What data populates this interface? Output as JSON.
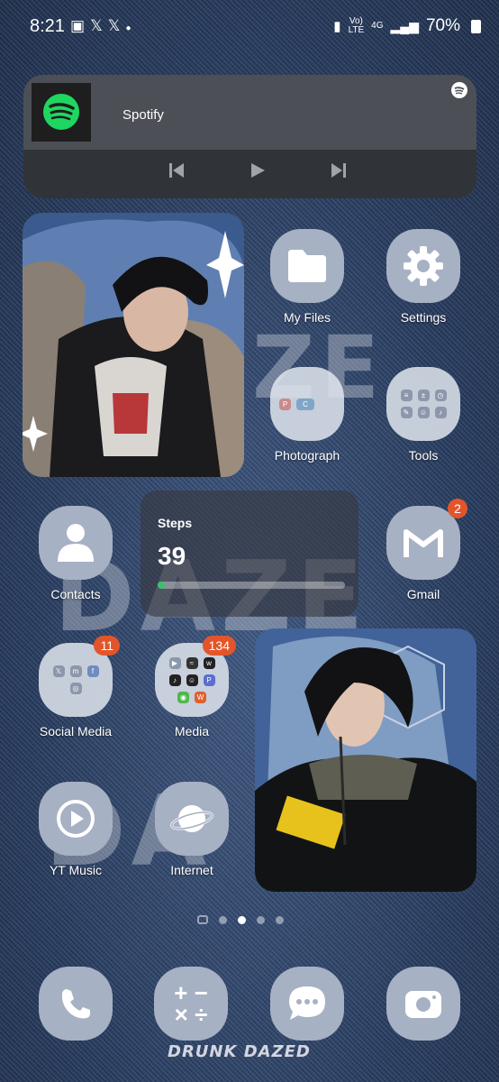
{
  "status_bar": {
    "time": "8:21",
    "left_icons": [
      "gallery-icon",
      "x-icon",
      "x-icon",
      "dot-icon"
    ],
    "network": "4G",
    "lte": "LTE",
    "battery": "70%"
  },
  "media_widget": {
    "app_name": "Spotify",
    "controls": [
      "previous",
      "play",
      "next"
    ]
  },
  "wallpaper_text": [
    "ZE",
    "DAZE",
    "DA",
    "DRUNK DAZED"
  ],
  "apps": {
    "my_files": "My Files",
    "settings": "Settings",
    "photograph": "Photograph",
    "tools": "Tools",
    "contacts": "Contacts",
    "gmail": "Gmail",
    "social_media": "Social Media",
    "media": "Media",
    "yt_music": "YT Music",
    "internet": "Internet"
  },
  "badges": {
    "gmail": "2",
    "social_media": "11",
    "media": "134"
  },
  "steps_widget": {
    "title": "Steps",
    "count": "39",
    "progress": 0.04
  },
  "page_indicator": {
    "pages": 4,
    "active": 2
  },
  "dock": [
    "phone-icon",
    "calculator-icon",
    "messages-icon",
    "camera-icon"
  ],
  "colors": {
    "icon_bg": "#a7b1c4",
    "badge": "#e2552b",
    "spotify_green": "#1ed760",
    "steps_bar": "#3cc06b"
  }
}
